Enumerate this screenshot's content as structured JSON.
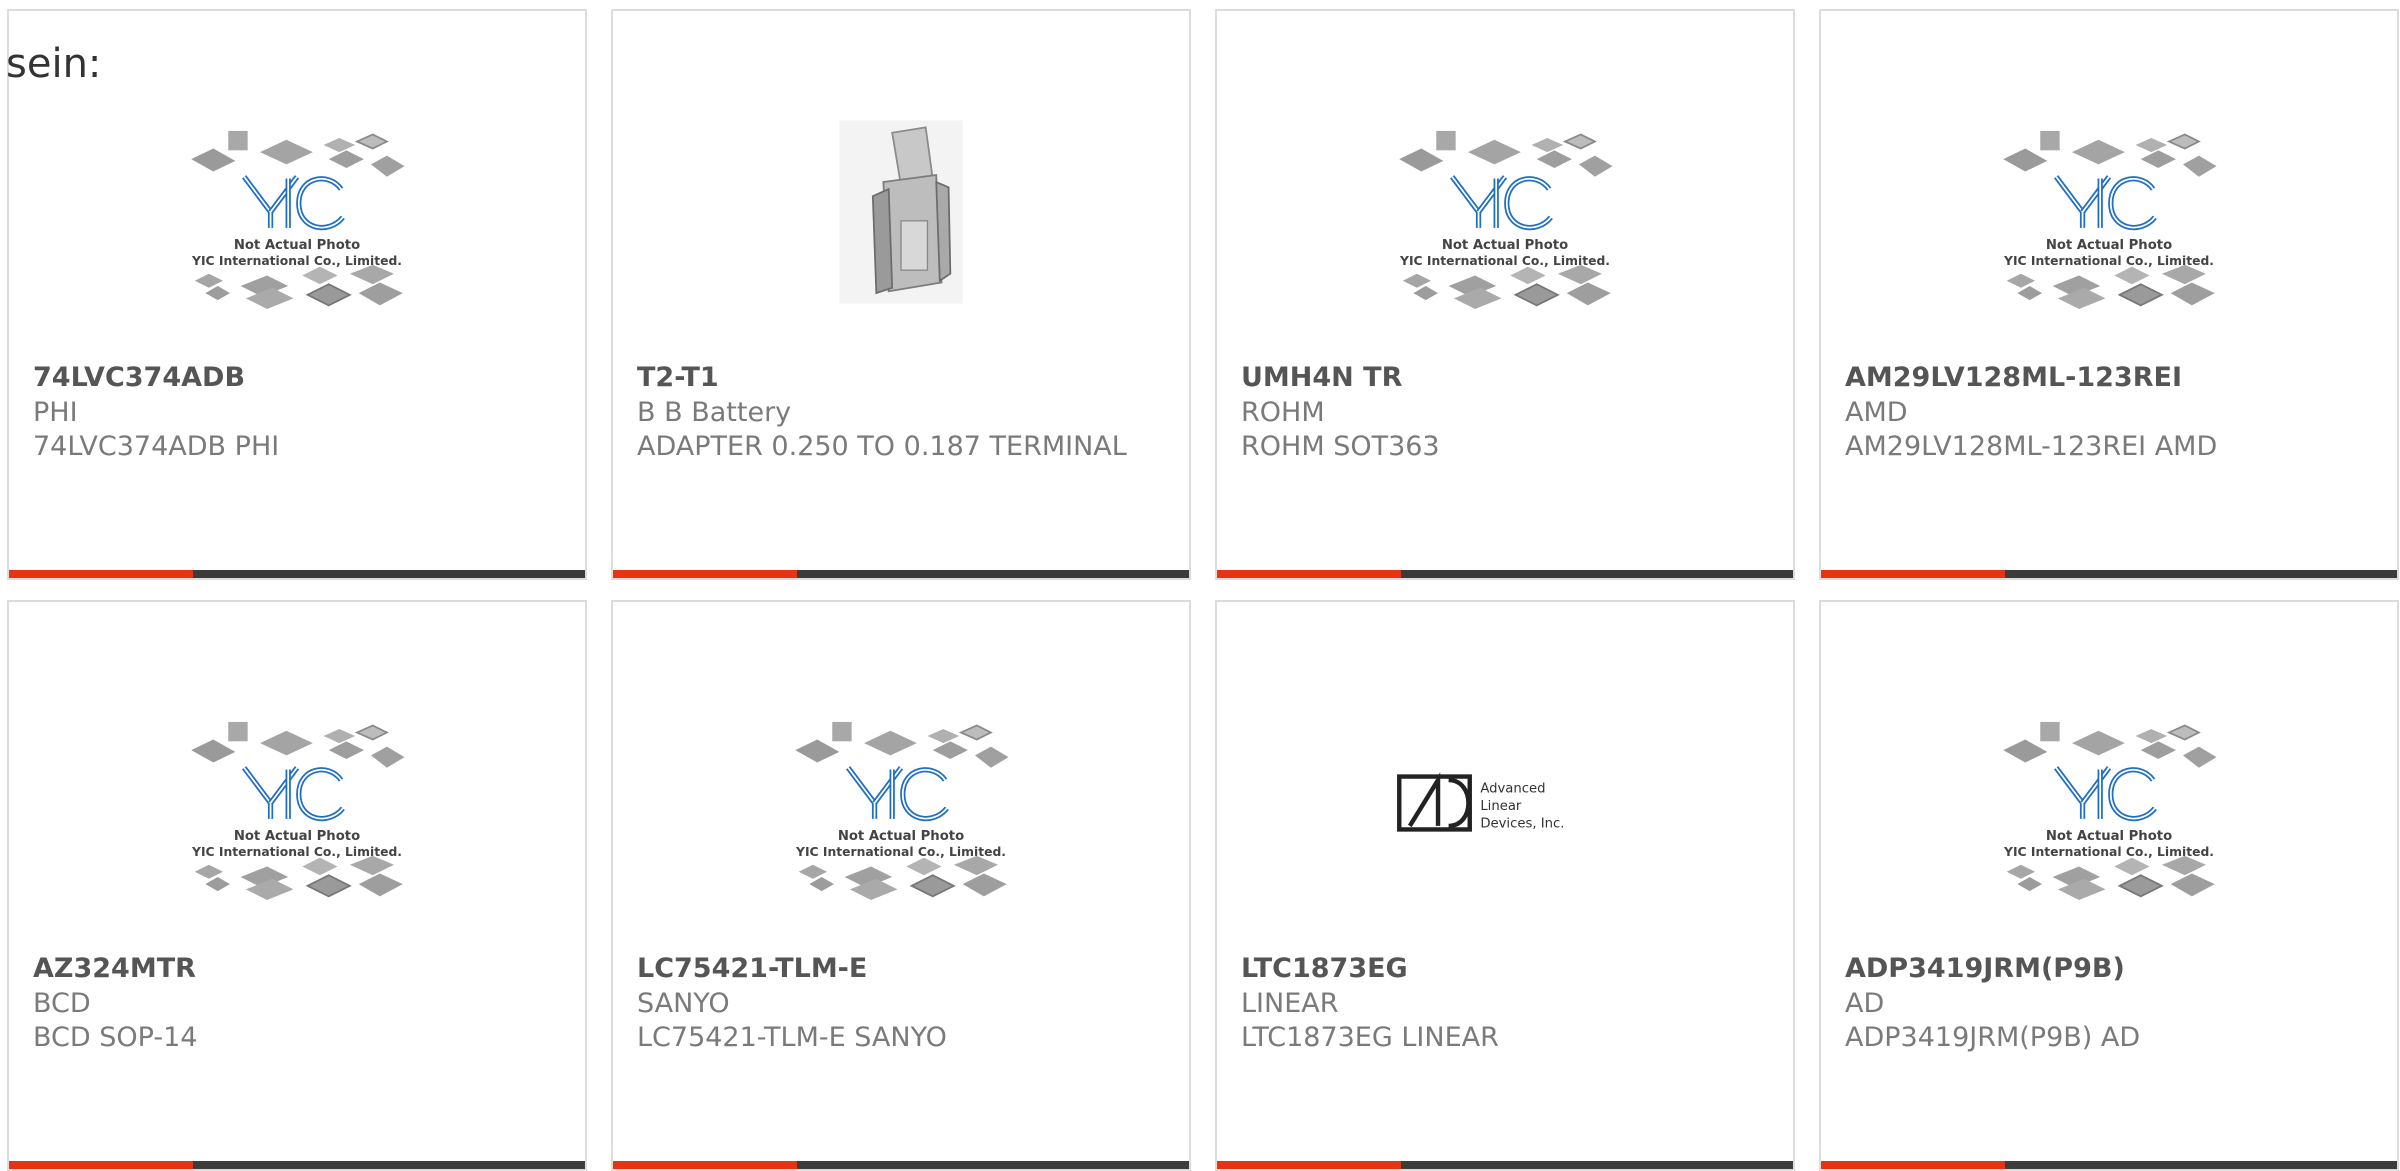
{
  "page": {
    "lead_text": "sein:"
  },
  "theme": {
    "accent_color": "#e63412",
    "bar_color": "#3c3c3c",
    "border_color": "#dcdcdc",
    "yic_blue": "#1e6fc4"
  },
  "placeholder_image": {
    "brand": "YIC",
    "line1": "Not Actual Photo",
    "line2": "YIC International Co., Limited."
  },
  "ald_logo": {
    "word1": "Advanced",
    "word2": "Linear",
    "word3": "Devices, Inc."
  },
  "products": [
    {
      "part": "74LVC374ADB",
      "brand": "PHI",
      "description": "74LVC374ADB PHI",
      "image": "yic-placeholder-image",
      "progress": 0.32
    },
    {
      "part": "T2-T1",
      "brand": "B B Battery",
      "description": "ADAPTER 0.250 TO 0.187 TERMINAL",
      "image": "terminal-adapter-photo",
      "progress": 0.32
    },
    {
      "part": "UMH4N TR",
      "brand": "ROHM",
      "description": "ROHM SOT363",
      "image": "yic-placeholder-image",
      "progress": 0.32
    },
    {
      "part": "AM29LV128ML-123REI",
      "brand": "AMD",
      "description": "AM29LV128ML-123REI AMD",
      "image": "yic-placeholder-image",
      "progress": 0.32
    },
    {
      "part": "AZ324MTR",
      "brand": "BCD",
      "description": "BCD SOP-14",
      "image": "yic-placeholder-image",
      "progress": 0.32
    },
    {
      "part": "LC75421-TLM-E",
      "brand": "SANYO",
      "description": "LC75421-TLM-E SANYO",
      "image": "yic-placeholder-image",
      "progress": 0.32
    },
    {
      "part": "LTC1873EG",
      "brand": "LINEAR",
      "description": "LTC1873EG LINEAR",
      "image": "advanced-linear-devices-logo",
      "progress": 0.32
    },
    {
      "part": "ADP3419JRM(P9B)",
      "brand": "AD",
      "description": "ADP3419JRM(P9B) AD",
      "image": "yic-placeholder-image",
      "progress": 0.32
    }
  ]
}
